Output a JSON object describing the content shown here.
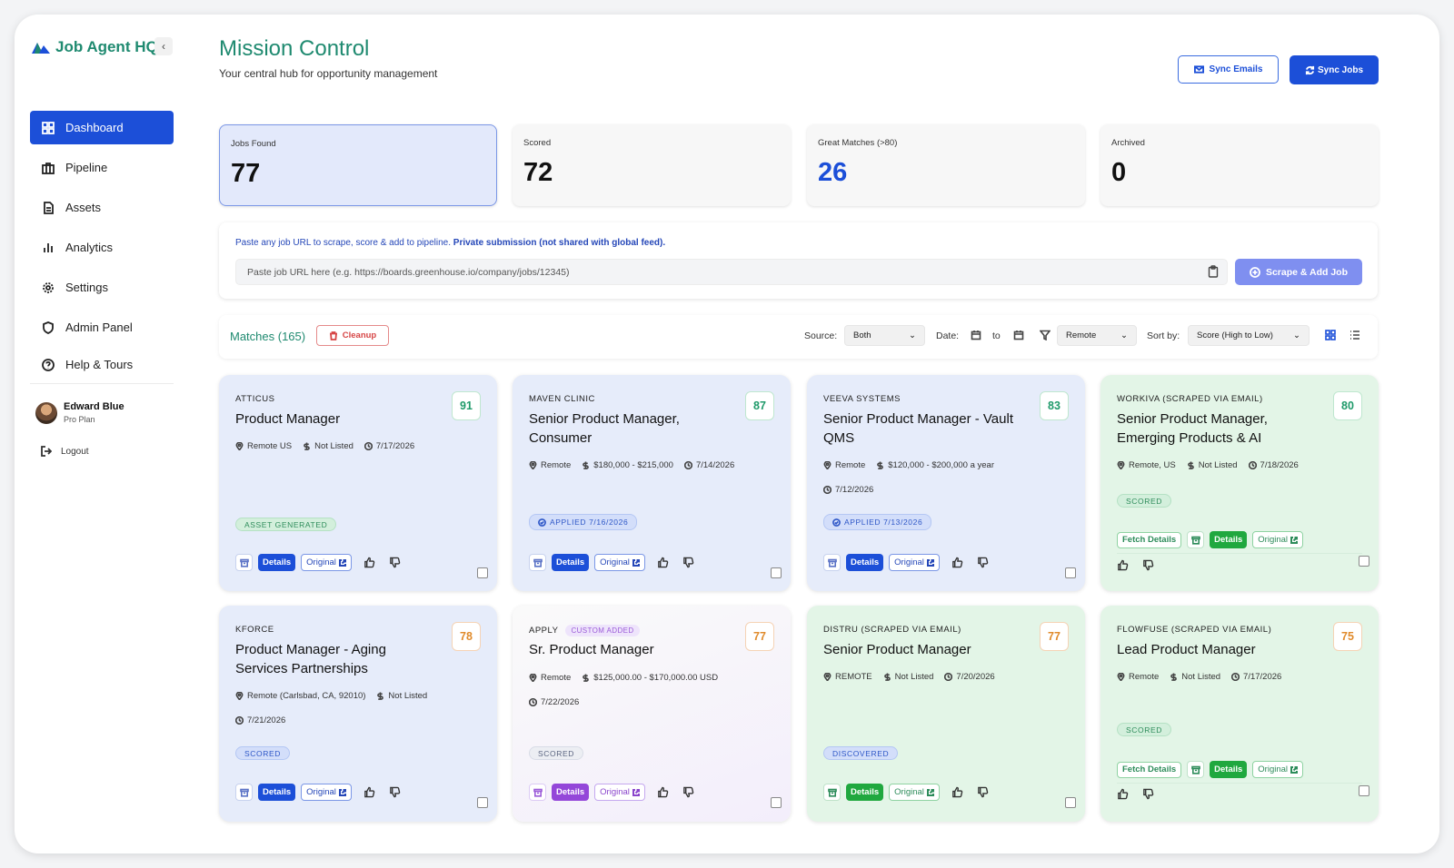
{
  "app": {
    "name": "Job Agent HQ"
  },
  "nav": [
    {
      "label": "Dashboard",
      "icon": "grid-icon"
    },
    {
      "label": "Pipeline",
      "icon": "briefcase-icon"
    },
    {
      "label": "Assets",
      "icon": "document-icon"
    },
    {
      "label": "Analytics",
      "icon": "bar-chart-icon"
    },
    {
      "label": "Settings",
      "icon": "gear-icon"
    },
    {
      "label": "Admin Panel",
      "icon": "shield-icon"
    },
    {
      "label": "Help & Tours",
      "icon": "help-circle-icon"
    }
  ],
  "user": {
    "name": "Edward Blue",
    "plan": "Pro Plan",
    "logout": "Logout"
  },
  "header": {
    "title": "Mission Control",
    "subtitle": "Your central hub for opportunity management",
    "sync_emails": "Sync Emails",
    "sync_jobs": "Sync Jobs"
  },
  "stats": [
    {
      "label": "Jobs Found",
      "value": "77"
    },
    {
      "label": "Scored",
      "value": "72"
    },
    {
      "label": "Great Matches (>80)",
      "value": "26"
    },
    {
      "label": "Archived",
      "value": "0"
    }
  ],
  "scrape": {
    "hint": "Paste any job URL to scrape, score & add to pipeline.",
    "hint_bold": "Private submission (not shared with global feed).",
    "placeholder": "Paste job URL here (e.g. https://boards.greenhouse.io/company/jobs/12345)",
    "button": "Scrape & Add Job"
  },
  "filters": {
    "matches_title": "Matches (165)",
    "cleanup": "Cleanup",
    "source_label": "Source:",
    "source_value": "Both",
    "date_label": "Date:",
    "date_to": "to",
    "location_value": "Remote",
    "sort_label": "Sort by:",
    "sort_value": "Score (High to Low)"
  },
  "card_labels": {
    "details": "Details",
    "original": "Original",
    "fetch": "Fetch Details"
  },
  "jobs": [
    {
      "company": "ATTICUS",
      "title": "Product Manager",
      "score": "91",
      "location": "Remote US",
      "salary": "Not Listed",
      "date": "7/17/2026",
      "status": "ASSET GENERATED"
    },
    {
      "company": "MAVEN CLINIC",
      "title": "Senior Product Manager, Consumer",
      "score": "87",
      "location": "Remote",
      "salary": "$180,000 - $215,000",
      "date": "7/14/2026",
      "status": "APPLIED 7/16/2026"
    },
    {
      "company": "VEEVA SYSTEMS",
      "title": "Senior Product Manager - Vault QMS",
      "score": "83",
      "location": "Remote",
      "salary": "$120,000 - $200,000 a year",
      "date": "7/12/2026",
      "status": "APPLIED 7/13/2026"
    },
    {
      "company": "WORKIVA (SCRAPED VIA EMAIL)",
      "title": "Senior Product Manager, Emerging Products & AI",
      "score": "80",
      "location": "Remote, US",
      "salary": "Not Listed",
      "date": "7/18/2026",
      "status": "SCORED"
    },
    {
      "company": "KFORCE",
      "title": "Product Manager - Aging Services Partnerships",
      "score": "78",
      "location": "Remote (Carlsbad, CA, 92010)",
      "salary": "Not Listed",
      "date": "7/21/2026",
      "status": "SCORED"
    },
    {
      "company": "APPLY",
      "tag": "CUSTOM ADDED",
      "title": "Sr. Product Manager",
      "score": "77",
      "location": "Remote",
      "salary": "$125,000.00 - $170,000.00 USD",
      "date": "7/22/2026",
      "status": "SCORED"
    },
    {
      "company": "DISTRU (SCRAPED VIA EMAIL)",
      "title": "Senior Product Manager",
      "score": "77",
      "location": "REMOTE",
      "salary": "Not Listed",
      "date": "7/20/2026",
      "status": "DISCOVERED"
    },
    {
      "company": "FLOWFUSE (SCRAPED VIA EMAIL)",
      "title": "Lead Product Manager",
      "score": "75",
      "location": "Remote",
      "salary": "Not Listed",
      "date": "7/17/2026",
      "status": "SCORED"
    }
  ]
}
